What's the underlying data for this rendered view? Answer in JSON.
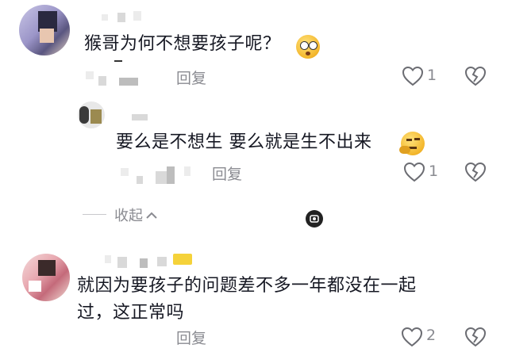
{
  "comments": [
    {
      "text": "猴哥为何不想要孩子呢？",
      "emoji": "flushed-face-emoji",
      "reply_label": "回复",
      "likes": "1"
    },
    {
      "text": "要么是不想生 要么就是生不出来",
      "emoji": "thinking-face-emoji",
      "reply_label": "回复",
      "likes": "1"
    },
    {
      "text_line1": "就因为要孩子的问题差不多一年都没在一起",
      "text_line2": "过，这正常吗",
      "reply_label": "回复",
      "likes": "2"
    }
  ],
  "collapse_label": "收起",
  "colors": {
    "text": "#161823",
    "muted": "#8a8b91",
    "icon": "#6b6c72"
  }
}
